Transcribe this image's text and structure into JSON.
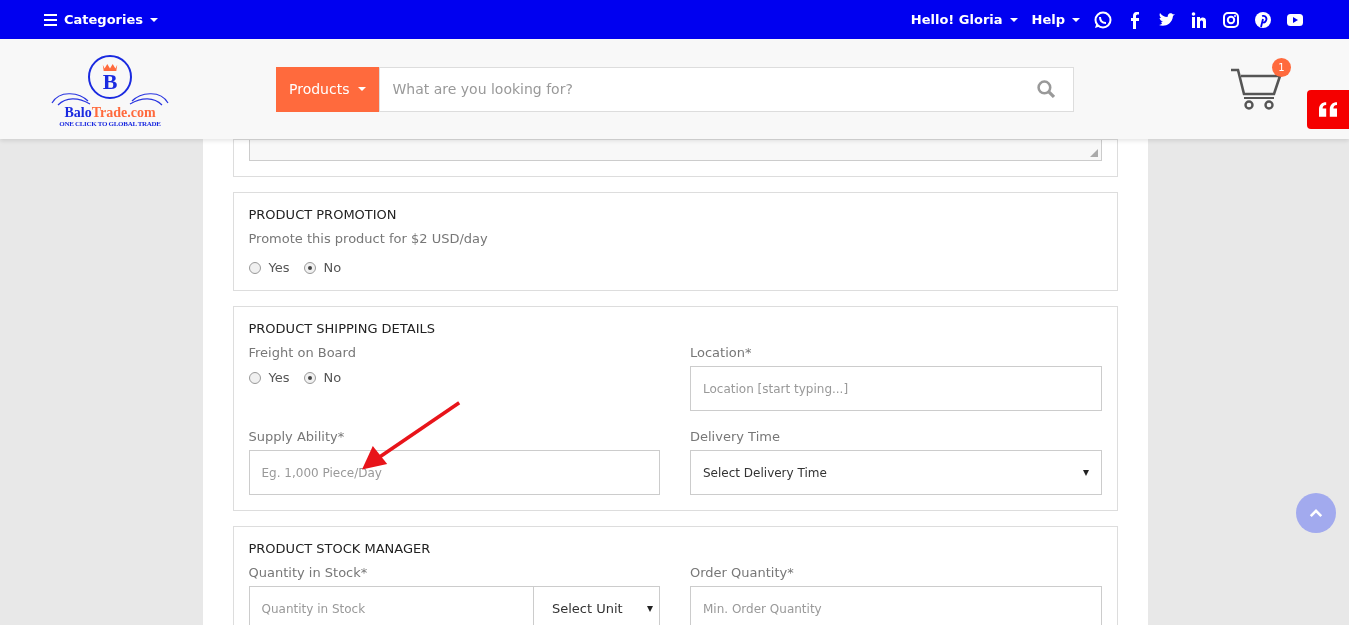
{
  "top_bar": {
    "categories": "Categories",
    "greeting": "Hello! Gloria",
    "help": "Help"
  },
  "header": {
    "logo": {
      "brand_first": "Balo",
      "brand_second": "Trade.com",
      "tagline": "ONE CLICK TO GLOBAL TRADE",
      "letter": "B"
    },
    "search": {
      "category": "Products",
      "placeholder": "What are you looking for?"
    },
    "cart_count": "1"
  },
  "sections": [
    {
      "title": "PRODUCT PROMOTION",
      "description": "Promote this product for $2 USD/day",
      "fields": [
        {
          "kind": "radio",
          "options": [
            {
              "label": "Yes",
              "selected": false
            },
            {
              "label": "No",
              "selected": true
            }
          ]
        }
      ]
    },
    {
      "title": "PRODUCT SHIPPING DETAILS",
      "fields": [
        {
          "kind": "radio",
          "label": "Freight on Board",
          "options": [
            {
              "label": "Yes",
              "selected": false
            },
            {
              "label": "No",
              "selected": true
            }
          ]
        },
        {
          "kind": "input",
          "label": "Location*",
          "placeholder": "Location [start typing...]"
        },
        {
          "kind": "input",
          "label": "Supply Ability*",
          "placeholder": "Eg. 1,000 Piece/Day"
        },
        {
          "kind": "select",
          "label": "Delivery Time",
          "value": "Select Delivery Time"
        }
      ]
    },
    {
      "title": "PRODUCT STOCK MANAGER",
      "fields": [
        {
          "kind": "input_unit",
          "label": "Quantity in Stock*",
          "placeholder": "Quantity in Stock",
          "unit": "Select Unit"
        },
        {
          "kind": "input",
          "label": "Order Quantity*",
          "placeholder": "Min. Order Quantity"
        }
      ]
    }
  ]
}
